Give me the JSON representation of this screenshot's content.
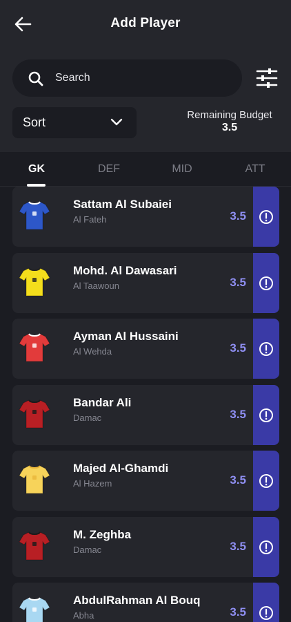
{
  "header": {
    "title": "Add Player",
    "back_icon": "arrow-left-icon"
  },
  "search": {
    "placeholder": "Search",
    "value": ""
  },
  "filter": {
    "icon": "sliders-icon"
  },
  "sort": {
    "label": "Sort",
    "icon": "chevron-down-icon"
  },
  "budget": {
    "label": "Remaining Budget",
    "value": "3.5"
  },
  "tabs": [
    {
      "label": "GK",
      "active": true
    },
    {
      "label": "DEF",
      "active": false
    },
    {
      "label": "MID",
      "active": false
    },
    {
      "label": "ATT",
      "active": false
    }
  ],
  "players": [
    {
      "name": "Sattam Al Subaiei",
      "team": "Al Fateh",
      "price": "3.5",
      "kit_color": "#2d57c8",
      "kit_accent": "#ffffff"
    },
    {
      "name": "Mohd. Al Dawasari",
      "team": "Al Taawoun",
      "price": "3.5",
      "kit_color": "#f4de1c",
      "kit_accent": "#222222"
    },
    {
      "name": "Ayman Al Hussaini",
      "team": "Al Wehda",
      "price": "3.5",
      "kit_color": "#e23b3b",
      "kit_accent": "#ffffff"
    },
    {
      "name": "Bandar Ali",
      "team": "Damac",
      "price": "3.5",
      "kit_color": "#b81f24",
      "kit_accent": "#1a1a1a"
    },
    {
      "name": "Majed Al-Ghamdi",
      "team": "Al Hazem",
      "price": "3.5",
      "kit_color": "#f7d35a",
      "kit_accent": "#e9b63a"
    },
    {
      "name": "M. Zeghba",
      "team": "Damac",
      "price": "3.5",
      "kit_color": "#b81f24",
      "kit_accent": "#1a1a1a"
    },
    {
      "name": "AbdulRahman Al Bouq",
      "team": "Abha",
      "price": "3.5",
      "kit_color": "#a9d8f2",
      "kit_accent": "#ffffff"
    }
  ],
  "colors": {
    "background": "#1b1c22",
    "panel": "#25262c",
    "price": "#8f8ff2",
    "info_button": "#3a3aa6"
  },
  "row_icon": "info-circle-icon"
}
